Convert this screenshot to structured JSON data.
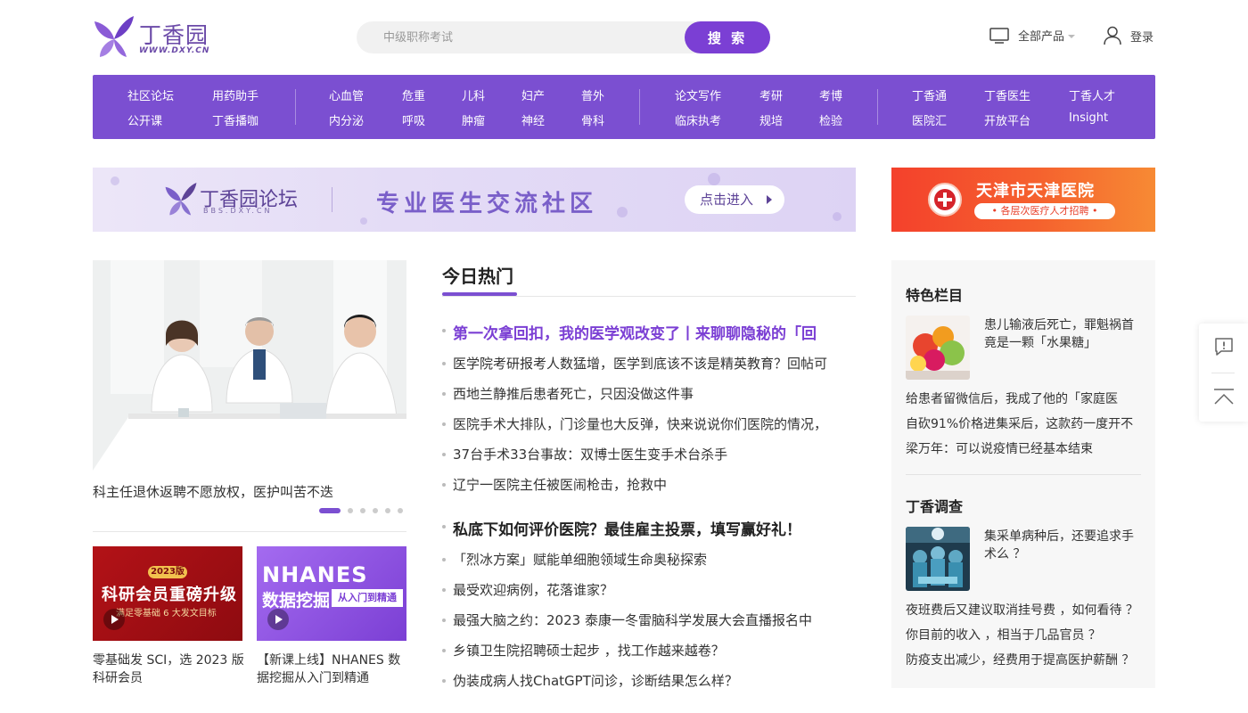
{
  "header": {
    "logo_name": "丁香园",
    "logo_url": "WWW.DXY.CN",
    "search_placeholder": "中级职称考试",
    "search_button": "搜 索",
    "products_label": "全部产品",
    "login_label": "登录"
  },
  "nav": {
    "group1": [
      "社区论坛",
      "用药助手",
      "公开课",
      "丁香播咖"
    ],
    "group2": [
      "心血管",
      "危重",
      "儿科",
      "妇产",
      "普外",
      "内分泌",
      "呼吸",
      "肿瘤",
      "神经",
      "骨科"
    ],
    "group3": [
      "论文写作",
      "考研",
      "考博",
      "临床执考",
      "规培",
      "检验"
    ],
    "group4": [
      "丁香通",
      "丁香医生",
      "丁香人才",
      "医院汇",
      "开放平台",
      "Insight"
    ]
  },
  "forum_banner": {
    "logo_name": "丁香园论坛",
    "logo_url": "BBS.DXY.CN",
    "slogan": "专业医生交流社区",
    "enter_label": "点击进入"
  },
  "hospital_banner": {
    "name": "天津市天津医院",
    "tagline": "各层次医疗人才招聘"
  },
  "hero": {
    "caption": "科主任退休返聘不愿放权，医护叫苦不迭"
  },
  "promos": [
    {
      "badge": "2023版",
      "headline": "科研会员重磅升级",
      "subline": "满足零基础 6 大发文目标",
      "caption": "零基础发 SCI，选 2023 版科研会员"
    },
    {
      "headline1": "NHANES",
      "headline2": "数据挖掘",
      "tag": "从入门到精通",
      "caption": "【新课上线】NHANES 数据挖掘从入门到精通"
    }
  ],
  "hot": {
    "title": "今日热门",
    "group1_headline": "第一次拿回扣，我的医学观改变了丨来聊聊隐秘的「回",
    "group1_items": [
      "医学院考研报考人数猛增，医学到底该不该是精英教育？回帖可",
      "西地兰静推后患者死亡，只因没做这件事",
      "医院手术大排队，门诊量也大反弹，快来说说你们医院的情况，",
      "37台手术33台事故：双博士医生变手术台杀手",
      "辽宁一医院主任被医闹枪击，抢救中"
    ],
    "group2_headline": "私底下如何评价医院？最佳雇主投票，填写赢好礼！",
    "group2_items": [
      "「烈冰方案」赋能单细胞领域生命奥秘探索",
      "最受欢迎病例，花落谁家？",
      "最强大脑之约：2023 泰康一冬雷脑科学发展大会直播报名中",
      "乡镇卫生院招聘硕士起步 ，找工作越来越卷？",
      "伪装成病人找ChatGPT问诊，诊断结果怎么样？"
    ]
  },
  "side": {
    "featured_title": "特色栏目",
    "featured_thumb_text": "患儿输液后死亡，罪魁祸首竟是一颗「水果糖」",
    "featured_links": [
      "给患者留微信后，我成了他的「家庭医",
      "自砍91%价格进集采后，这款药一度开不",
      "梁万年：可以说疫情已经基本结束"
    ],
    "survey_title": "丁香调查",
    "survey_thumb_text": "集采单病种后，还要追求手术么 ？",
    "survey_links": [
      "夜班费后又建议取消挂号费 ，如何看待 ？",
      "你目前的收入 ，相当于几品官员 ？",
      "防疫支出减少，经费用于提高医护薪酬 ？"
    ]
  },
  "colors": {
    "brand_purple": "#7b4fd1",
    "accent_purple": "#7b3fd4",
    "hospital_red": "#f4412c"
  }
}
